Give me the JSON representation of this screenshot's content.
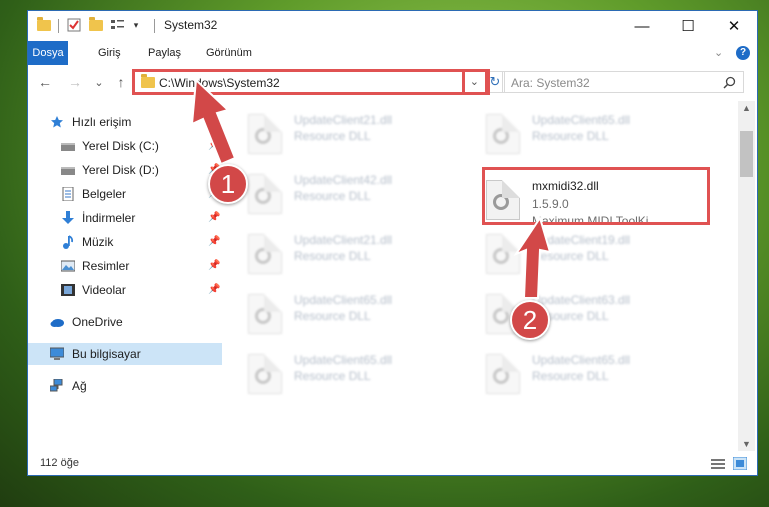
{
  "window": {
    "title": "System32",
    "controls": {
      "minimize": "—",
      "maximize": "☐",
      "close": "✕"
    }
  },
  "ribbon": {
    "tabs": [
      "Dosya",
      "Giriş",
      "Paylaş",
      "Görünüm"
    ],
    "collapse_icon": "chevron-down-icon",
    "help_icon": "help-icon"
  },
  "nav": {
    "back": "←",
    "forward": "→",
    "recent": "⌄",
    "up": "↑",
    "address": "C:\\Windows\\System32",
    "refresh": "↻",
    "search_placeholder": "Ara: System32"
  },
  "sidebar": {
    "items": [
      {
        "label": "Hızlı erişim",
        "icon": "star-icon",
        "pinned": false
      },
      {
        "label": "Yerel Disk (C:)",
        "icon": "drive-icon",
        "pinned": true
      },
      {
        "label": "Yerel Disk (D:)",
        "icon": "drive-icon",
        "pinned": true
      },
      {
        "label": "Belgeler",
        "icon": "documents-icon",
        "pinned": true
      },
      {
        "label": "İndirmeler",
        "icon": "download-icon",
        "pinned": true
      },
      {
        "label": "Müzik",
        "icon": "music-icon",
        "pinned": true
      },
      {
        "label": "Resimler",
        "icon": "pictures-icon",
        "pinned": true
      },
      {
        "label": "Videolar",
        "icon": "video-icon",
        "pinned": true
      },
      {
        "label": "OneDrive",
        "icon": "cloud-icon",
        "pinned": false
      },
      {
        "label": "Bu bilgisayar",
        "icon": "computer-icon",
        "pinned": false,
        "selected": true
      },
      {
        "label": "Ağ",
        "icon": "network-icon",
        "pinned": false
      }
    ]
  },
  "files": {
    "left": [
      {
        "name": "UpdateClient21.dll",
        "sub": "Resource DLL"
      },
      {
        "name": "UpdateClient42.dll",
        "sub": "Resource DLL"
      },
      {
        "name": "UpdateClient21.dll",
        "sub": "Resource DLL"
      },
      {
        "name": "UpdateClient65.dll",
        "sub": "Resource DLL"
      },
      {
        "name": "UpdateClient65.dll",
        "sub": "Resource DLL"
      }
    ],
    "right": [
      {
        "name": "UpdateClient65.dll",
        "sub": "Resource DLL"
      },
      {
        "name": "UpdateClient19.dll",
        "sub": "Resource DLL"
      },
      {
        "name": "UpdateClient63.dll",
        "sub": "Resource DLL"
      },
      {
        "name": "UpdateClient65.dll",
        "sub": "Resource DLL"
      }
    ],
    "highlighted": {
      "name": "mxmidi32.dll",
      "version": "1.5.9.0",
      "description": "Maximum MIDI ToolKi..."
    }
  },
  "status": {
    "count": "112 öğe"
  },
  "annotations": {
    "step1": "1",
    "step2": "2",
    "accent": "#d24848"
  }
}
